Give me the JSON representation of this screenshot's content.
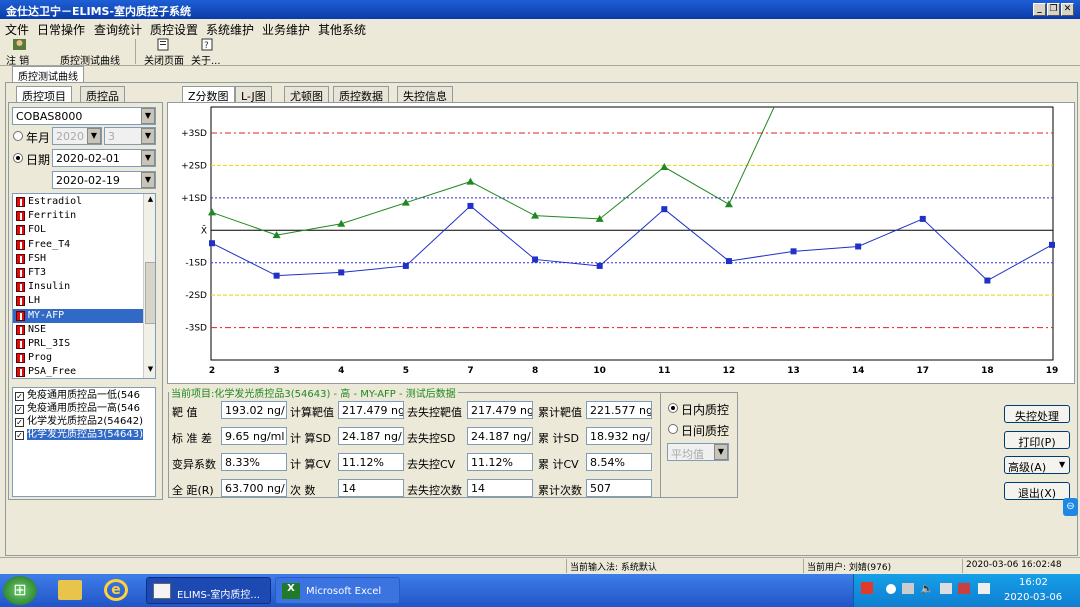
{
  "window": {
    "title": "金仕达卫宁－ELIMS-室内质控子系统"
  },
  "menu": [
    "文件",
    "日常操作",
    "查询统计",
    "质控设置",
    "系统维护",
    "业务维护",
    "其他系统"
  ],
  "toolbar": {
    "logout": "注  销",
    "qc_curve": "质控测试曲线",
    "close_page": "关闭页面",
    "about": "关于..."
  },
  "doc_tab": "质控测试曲线",
  "left_tabs": [
    "质控项目",
    "质控品"
  ],
  "instrument": "COBAS8000",
  "year_label": "年月",
  "year_value": "2020",
  "month_value": "3",
  "date_label": "日期",
  "date_from": "2020-02-01",
  "date_to": "2020-02-19",
  "items": [
    "Estradiol",
    "Ferritin",
    "FOL",
    "Free_T4",
    "FSH",
    "FT3",
    "Insulin",
    "LH",
    "MY-AFP",
    "NSE",
    "PRL_3IS",
    "Prog",
    "PSA_Free"
  ],
  "selected_item": "MY-AFP",
  "controls": [
    "免疫通用质控品一低(546",
    "免疫通用质控品一高(546",
    "化学发光质控品2(54642)",
    "化学发光质控品3(54643)"
  ],
  "chart_tabs": [
    "Z分数图",
    "L-J图",
    "尤顿图",
    "质控数据",
    "失控信息"
  ],
  "chart_data": {
    "type": "line",
    "x_ticks": [
      "2",
      "3",
      "4",
      "5",
      "7",
      "8",
      "10",
      "11",
      "12",
      "13",
      "14",
      "17",
      "18",
      "19"
    ],
    "y_ticks": [
      "+3SD",
      "+2SD",
      "+1SD",
      "X̄",
      "-1SD",
      "-2SD",
      "-3SD"
    ],
    "ylim": [
      -4,
      3.8
    ],
    "series": [
      {
        "color": "#208820",
        "marker": "triangle",
        "points": [
          [
            0,
            0.55
          ],
          [
            1,
            -0.15
          ],
          [
            2,
            0.2
          ],
          [
            3,
            0.85
          ],
          [
            4,
            1.5
          ],
          [
            5,
            0.45
          ],
          [
            6,
            0.35
          ],
          [
            7,
            1.95
          ],
          [
            8,
            0.8
          ],
          [
            8.7,
            3.8
          ]
        ]
      },
      {
        "color": "#2030c8",
        "marker": "square",
        "points": [
          [
            0,
            -0.4
          ],
          [
            1,
            -1.4
          ],
          [
            2,
            -1.3
          ],
          [
            3,
            -1.1
          ],
          [
            4,
            0.75
          ],
          [
            5,
            -0.9
          ],
          [
            6,
            -1.1
          ],
          [
            7,
            0.65
          ],
          [
            8,
            -0.95
          ],
          [
            9,
            -0.65
          ],
          [
            10,
            -0.5
          ],
          [
            11,
            0.35
          ],
          [
            12,
            -1.55
          ],
          [
            13,
            -0.45
          ]
        ]
      }
    ]
  },
  "info": {
    "header": "当前项目:化学发光质控品3(54643) - 高 - MY-AFP - 测试后数据",
    "target_label": "靶    值",
    "target": "193.02 ng/",
    "calc_target_label": "计算靶值",
    "calc_target": "217.479 ng",
    "oc_target_label": "去失控靶值",
    "oc_target": "217.479 ng",
    "cum_target_label": "累计靶值",
    "cum_target": "221.577 ng",
    "sd_label": "标 准 差",
    "sd": "9.65 ng/ml",
    "calc_sd_label": "计 算SD",
    "calc_sd": "24.187 ng/",
    "oc_sd_label": "去失控SD",
    "oc_sd": "24.187 ng/",
    "cum_sd_label": "累 计SD",
    "cum_sd": "18.932 ng/",
    "cv_label": "变异系数",
    "cv": "8.33%",
    "calc_cv_label": "计 算CV",
    "calc_cv": "11.12%",
    "oc_cv_label": "去失控CV",
    "oc_cv": "11.12%",
    "cum_cv_label": "累 计CV",
    "cum_cv": "8.54%",
    "range_label": "全 距(R)",
    "range": "63.700 ng/",
    "count_label": "次    数",
    "count": "14",
    "oc_count_label": "去失控次数",
    "oc_count": "14",
    "cum_count_label": "累计次数",
    "cum_count": "507"
  },
  "qc_mode": {
    "intra": "日内质控",
    "inter": "日间质控",
    "avg": "平均值"
  },
  "buttons": {
    "out_control": "失控处理",
    "print": "打印(P)",
    "advanced": "高级(A)",
    "exit": "退出(X)"
  },
  "status": {
    "input": "当前输入法: 系统默认",
    "user": "当前用户: 刘婧(976)",
    "datetime": "2020-03-06  16:02:48"
  },
  "taskbar": {
    "app1": "ELIMS-室内质控...",
    "app2": "Microsoft Excel",
    "time": "16:02",
    "date": "2020-03-06"
  },
  "colors": {
    "green_series": "#208820",
    "blue_series": "#2030c8",
    "red_line": "#e02020",
    "yellow_line": "#e8d800",
    "blue_line": "#3030d0"
  }
}
